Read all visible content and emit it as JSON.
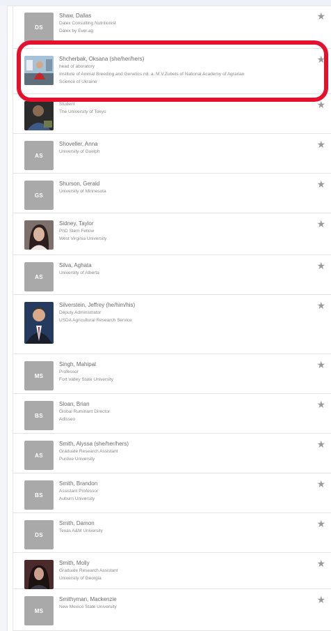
{
  "people": [
    {
      "name": "Shaw, Dallas",
      "lines": [
        "Dalex Consulting Nutritionist",
        "Dalex by Ever.ag"
      ],
      "initials": "DS",
      "photo": null
    },
    {
      "name": "Shcherbak, Oksana (she/her/hers)",
      "lines": [
        "head of aboratory",
        "Institute of Animal Breeding and Genetics nd. a. M.V.Zubets of National Academy of Agrarian",
        "Science of Ukraine"
      ],
      "initials": "",
      "photo": "lab"
    },
    {
      "name": "",
      "lines": [
        "Student",
        "The University of Tokyo"
      ],
      "initials": "",
      "photo": "man-dark"
    },
    {
      "name": "Shoveller, Anna",
      "lines": [
        "University of Guelph"
      ],
      "initials": "AS",
      "photo": null
    },
    {
      "name": "Shurson, Gerald",
      "lines": [
        "University of Minnesota"
      ],
      "initials": "GS",
      "photo": null
    },
    {
      "name": "Sidney, Taylor",
      "lines": [
        "PhD Stem Fellow",
        "West Virginia University"
      ],
      "initials": "",
      "photo": "woman"
    },
    {
      "name": "Silva, Aghata",
      "lines": [
        "University of Alberta"
      ],
      "initials": "AS",
      "photo": null
    },
    {
      "name": "Silverstein, Jeffrey (he/him/his)",
      "lines": [
        "Deputy Administrator",
        "USDA Agricultural Research Service"
      ],
      "initials": "",
      "photo": "suit"
    },
    {
      "name": "Singh, Mahipal",
      "lines": [
        "Professor",
        "Fort Valley State University"
      ],
      "initials": "MS",
      "photo": null
    },
    {
      "name": "Sloan, Brian",
      "lines": [
        "Global Ruminant Director",
        "Adisseo"
      ],
      "initials": "BS",
      "photo": null
    },
    {
      "name": "Smith, Alyssa (she/her/hers)",
      "lines": [
        "Graduate Research Assistant",
        "Purdue University"
      ],
      "initials": "AS",
      "photo": null
    },
    {
      "name": "Smith, Brandon",
      "lines": [
        "Assistant Professor",
        "Auburn University"
      ],
      "initials": "BS",
      "photo": null
    },
    {
      "name": "Smith, Damon",
      "lines": [
        "Texas A&M University"
      ],
      "initials": "DS",
      "photo": null
    },
    {
      "name": "Smith, Molly",
      "lines": [
        "Graduate Research Assistant",
        "University of Georgia"
      ],
      "initials": "",
      "photo": "woman2"
    },
    {
      "name": "Smithyman, Mackenzie",
      "lines": [
        "New Mexico State University"
      ],
      "initials": "MS",
      "photo": null
    }
  ],
  "colors": {
    "highlight": "#e3112d",
    "avatar": "#a9a9a9"
  },
  "icons": {
    "favorite": "star-icon"
  }
}
